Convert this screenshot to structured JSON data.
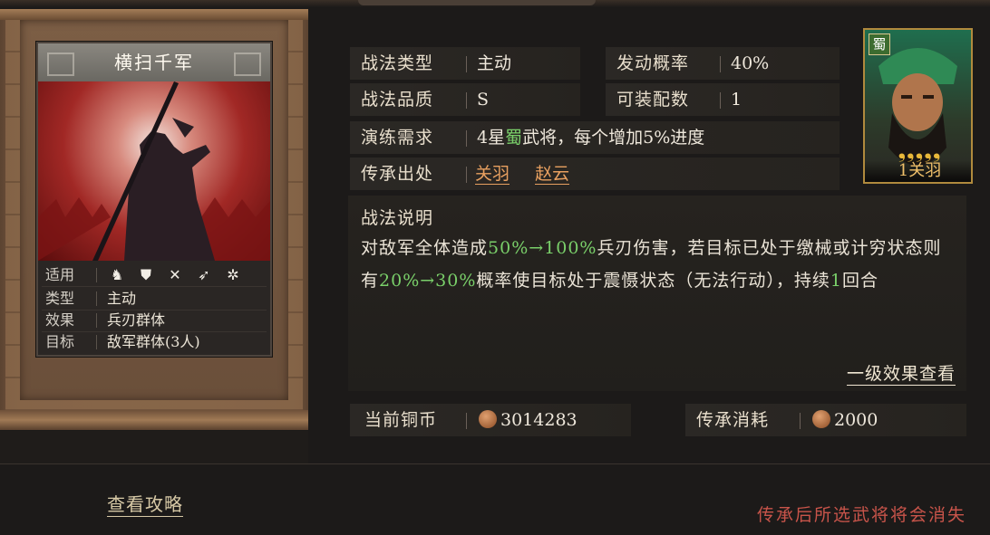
{
  "card": {
    "title": "横扫千军",
    "applicable_label": "适用",
    "applicable_icons": [
      "cavalry-icon",
      "shield-icon",
      "crossbow-icon",
      "spear-icon",
      "chariot-icon"
    ],
    "type_label": "类型",
    "type_value": "主动",
    "effect_label": "效果",
    "effect_value": "兵刃群体",
    "target_label": "目标",
    "target_value": "敌军群体(3人)"
  },
  "details": {
    "tactic_type_label": "战法类型",
    "tactic_type_value": "主动",
    "trigger_rate_label": "发动概率",
    "trigger_rate_value": "40%",
    "quality_label": "战法品质",
    "quality_value": "S",
    "equip_count_label": "可装配数",
    "equip_count_value": "1",
    "training_label": "演练需求",
    "training_value_pre": "4星",
    "training_value_faction": "蜀",
    "training_value_post": "武将，每个增加5%进度",
    "origin_label": "传承出处",
    "origin_heroes": [
      "关羽",
      "赵云"
    ]
  },
  "description": {
    "title": "战法说明",
    "p1": "对敌军全体造成",
    "p2": "50%→100%",
    "p3": "兵刃伤害，若目标已处于缴械或计穷状态则有",
    "p4": "20%→30%",
    "p5": "概率使目标处于震慑状态（无法行动），持续",
    "p6": "1",
    "p7": "回合",
    "effect_link": "一级效果查看"
  },
  "currency": {
    "current_label": "当前铜币",
    "current_value": "3014283",
    "cost_label": "传承消耗",
    "cost_value": "2000"
  },
  "hero": {
    "faction": "蜀",
    "name": "1关羽",
    "stars": "❟❟❟❟❟"
  },
  "footer": {
    "guide_link": "查看攻略",
    "warning": "传承后所选武将将会消失"
  },
  "colors": {
    "highlight": "#7ad06a",
    "link": "#e8a060",
    "warning": "#c8544a"
  }
}
